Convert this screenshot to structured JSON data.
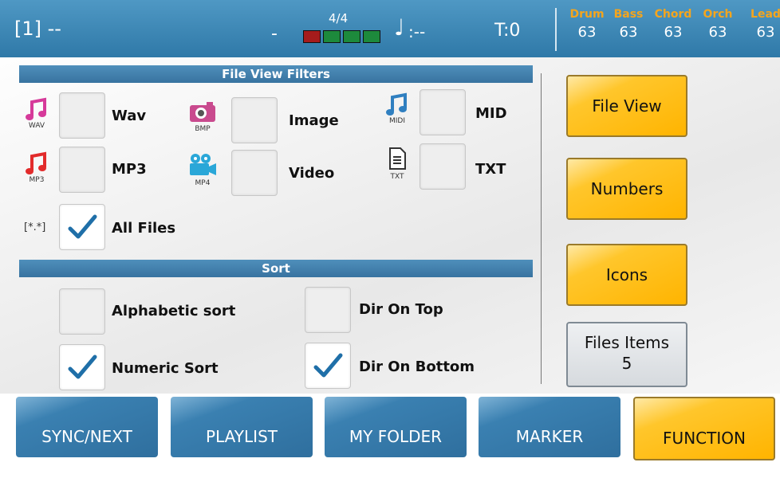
{
  "topbar": {
    "song": "[1] --",
    "dash": "-",
    "time_signature": "4/4",
    "note_value": ":--",
    "tempo": "T:0",
    "parts": [
      {
        "name": "Drum",
        "value": "63"
      },
      {
        "name": "Bass",
        "value": "63"
      },
      {
        "name": "Chord",
        "value": "63"
      },
      {
        "name": "Orch",
        "value": "63"
      },
      {
        "name": "Lead",
        "value": "63"
      }
    ],
    "beat_colors": [
      "#a51c1c",
      "#1d8a3c",
      "#1d8a3c",
      "#1d8a3c"
    ]
  },
  "filters": {
    "title": "File View Filters",
    "items": [
      {
        "icon": "music-note-icon",
        "icon_caption": "WAV",
        "label": "Wav",
        "checked": false
      },
      {
        "icon": "camera-icon",
        "icon_caption": "BMP",
        "label": "Image",
        "checked": false
      },
      {
        "icon": "music-note-icon",
        "icon_caption": "MIDI",
        "label": "MID",
        "checked": false
      },
      {
        "icon": "music-note-icon",
        "icon_caption": "MP3",
        "label": "MP3",
        "checked": false
      },
      {
        "icon": "video-camera-icon",
        "icon_caption": "MP4",
        "label": "Video",
        "checked": false
      },
      {
        "icon": "document-icon",
        "icon_caption": "TXT",
        "label": "TXT",
        "checked": false
      }
    ],
    "all_files": {
      "prefix": "[*.*]",
      "label": "All Files",
      "checked": true
    }
  },
  "sort": {
    "title": "Sort",
    "items": [
      {
        "label": "Alphabetic sort",
        "checked": false
      },
      {
        "label": "Dir On Top",
        "checked": false
      },
      {
        "label": "Numeric Sort",
        "checked": true
      },
      {
        "label": "Dir On Bottom",
        "checked": true
      }
    ]
  },
  "side_buttons": {
    "file_view": "File View",
    "numbers": "Numbers",
    "icons": "Icons",
    "files_items_label": "Files Items",
    "files_items_value": "5"
  },
  "bottom_tabs": [
    {
      "label": "SYNC/NEXT",
      "active": false
    },
    {
      "label": "PLAYLIST",
      "active": false
    },
    {
      "label": "MY FOLDER",
      "active": false
    },
    {
      "label": "MARKER",
      "active": false
    },
    {
      "label": "FUNCTION",
      "active": true
    }
  ],
  "colors": {
    "accent": "#ffb400",
    "header_blue": "#3873a0",
    "part_name": "#f4a51d",
    "checkmark": "#1f6fa8"
  }
}
